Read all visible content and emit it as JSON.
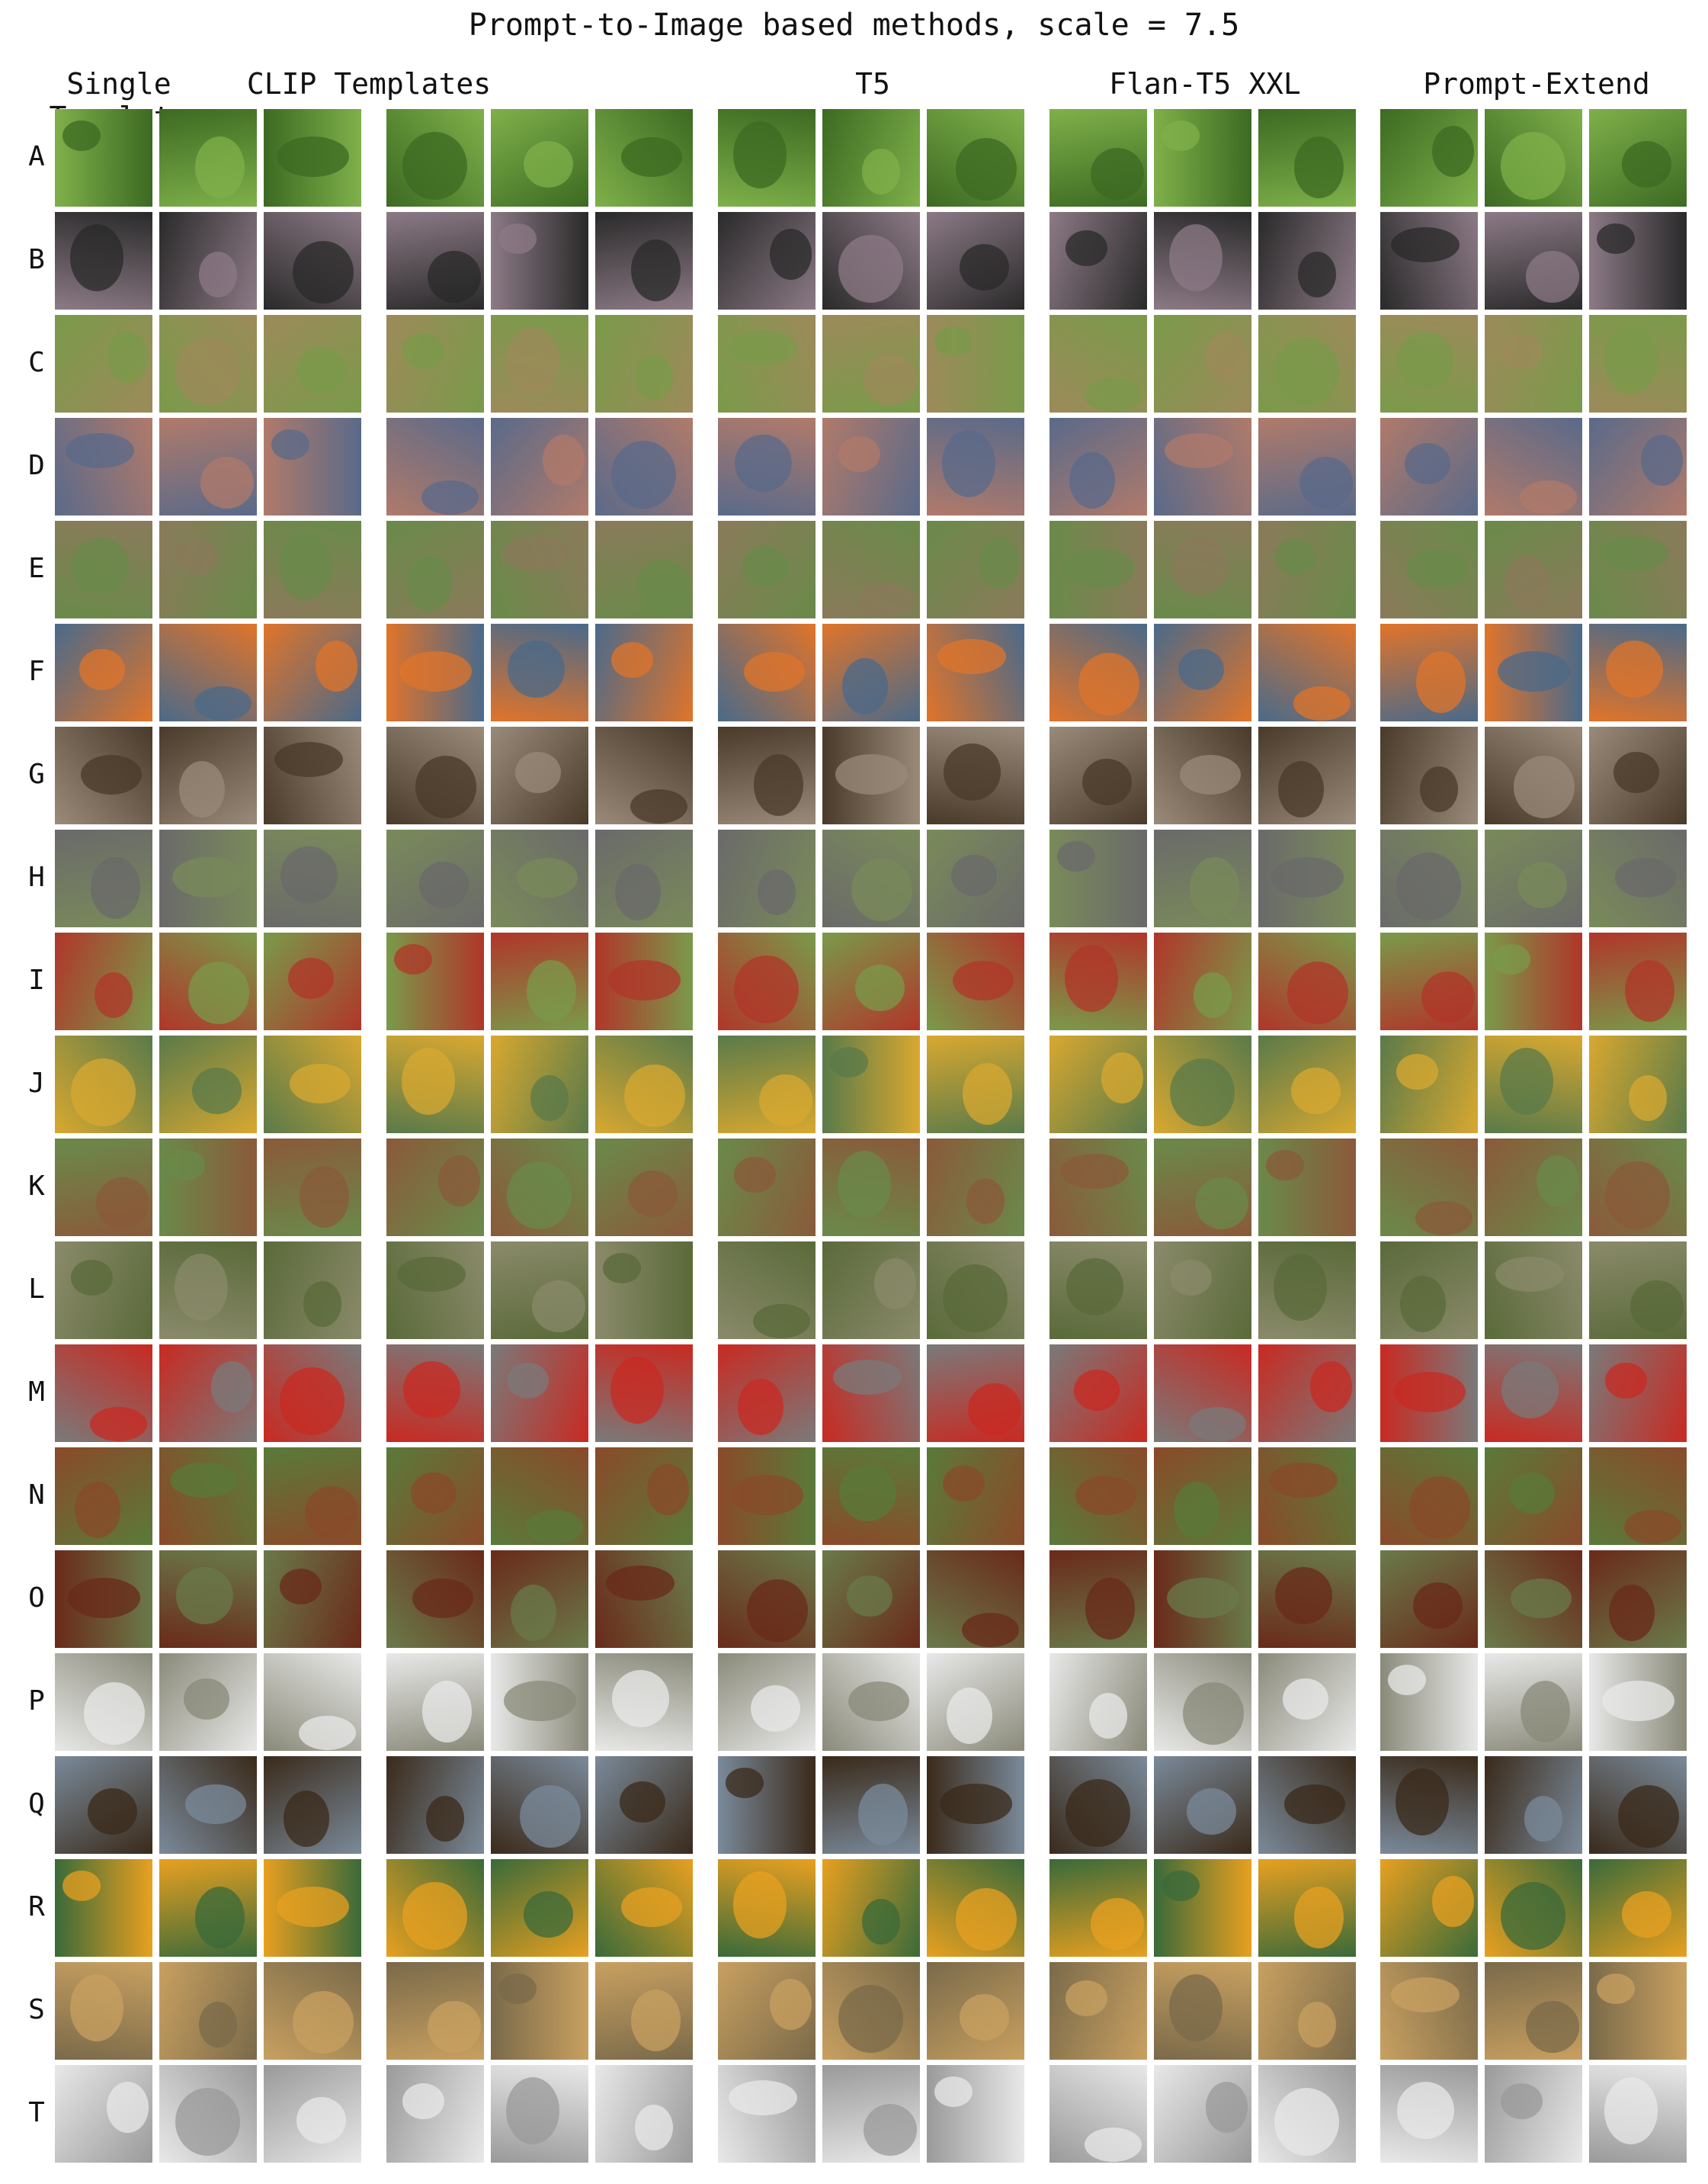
{
  "title": "Prompt-to-Image based methods, scale = 7.5",
  "columns": [
    "Single Template",
    "CLIP Templates",
    "T5",
    "Flan-T5 XXL",
    "Prompt-Extend"
  ],
  "rows": [
    "A",
    "B",
    "C",
    "D",
    "E",
    "F",
    "G",
    "H",
    "I",
    "J",
    "K",
    "L",
    "M",
    "N",
    "O",
    "P",
    "Q",
    "R",
    "S",
    "T"
  ],
  "images_per_cell": 3,
  "row_colors": [
    [
      "#7fb04a",
      "#3c6a22"
    ],
    [
      "#8c7a86",
      "#2a2a2a"
    ],
    [
      "#9c8a5a",
      "#7a9a4a"
    ],
    [
      "#b07a6a",
      "#5a6a8a"
    ],
    [
      "#8a7a5a",
      "#6a8a4a"
    ],
    [
      "#4a6a8a",
      "#e0742a"
    ],
    [
      "#9a8a7a",
      "#4a3a2a"
    ],
    [
      "#7a8a5a",
      "#6a6a6a"
    ],
    [
      "#7a9a4a",
      "#b0362a"
    ],
    [
      "#5a7a4a",
      "#d8a830"
    ],
    [
      "#6a8a4a",
      "#8a5a3a"
    ],
    [
      "#8a8a6a",
      "#5a6a3a"
    ],
    [
      "#7a7a7a",
      "#c82a22"
    ],
    [
      "#5a7a3a",
      "#8a4a2a"
    ],
    [
      "#6a7a4a",
      "#6a2a1a"
    ],
    [
      "#8a8a7a",
      "#e8e8e8"
    ],
    [
      "#7a8a9a",
      "#3a2a1a"
    ],
    [
      "#3a6a3a",
      "#e8a020"
    ],
    [
      "#7a6a4a",
      "#c8a060"
    ],
    [
      "#9a9a9a",
      "#e8e8e8"
    ]
  ]
}
